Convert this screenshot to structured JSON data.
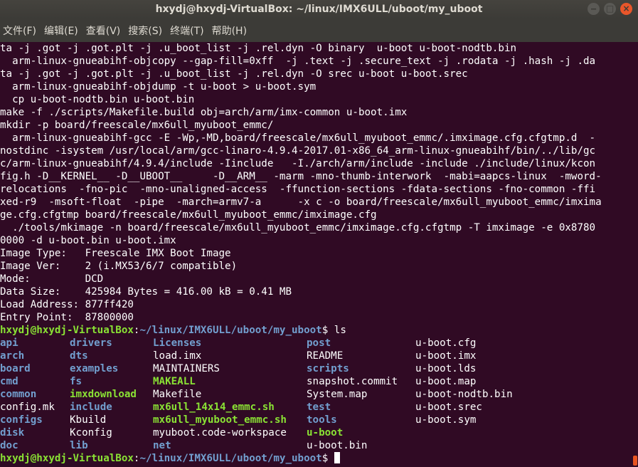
{
  "window": {
    "title": "hxydj@hxydj-VirtualBox: ~/linux/IMX6ULL/uboot/my_uboot",
    "minimize_label": "‒",
    "maximize_label": "□",
    "close_label": "×"
  },
  "menubar": {
    "items": [
      "文件(F)",
      "编辑(E)",
      "查看(V)",
      "搜索(S)",
      "终端(T)",
      "帮助(H)"
    ]
  },
  "terminal": {
    "output_lines": [
      "ta -j .got -j .got.plt -j .u_boot_list -j .rel.dyn -O binary  u-boot u-boot-nodtb.bin",
      "  arm-linux-gnueabihf-objcopy --gap-fill=0xff  -j .text -j .secure_text -j .rodata -j .hash -j .da",
      "ta -j .got -j .got.plt -j .u_boot_list -j .rel.dyn -O srec u-boot u-boot.srec",
      "  arm-linux-gnueabihf-objdump -t u-boot > u-boot.sym",
      "  cp u-boot-nodtb.bin u-boot.bin",
      "make -f ./scripts/Makefile.build obj=arch/arm/imx-common u-boot.imx",
      "mkdir -p board/freescale/mx6ull_myuboot_emmc/",
      "  arm-linux-gnueabihf-gcc -E -Wp,-MD,board/freescale/mx6ull_myuboot_emmc/.imximage.cfg.cfgtmp.d  -",
      "nostdinc -isystem /usr/local/arm/gcc-linaro-4.9.4-2017.01-x86_64_arm-linux-gnueabihf/bin/../lib/gc",
      "c/arm-linux-gnueabihf/4.9.4/include -Iinclude   -I./arch/arm/include -include ./include/linux/kcon",
      "fig.h -D__KERNEL__ -D__UBOOT__     -D__ARM__ -marm -mno-thumb-interwork  -mabi=aapcs-linux  -mword-",
      "relocations  -fno-pic  -mno-unaligned-access  -ffunction-sections -fdata-sections -fno-common -ffi",
      "xed-r9  -msoft-float  -pipe  -march=armv7-a      -x c -o board/freescale/mx6ull_myuboot_emmc/imxima",
      "ge.cfg.cfgtmp board/freescale/mx6ull_myuboot_emmc/imximage.cfg",
      "  ./tools/mkimage -n board/freescale/mx6ull_myuboot_emmc/imximage.cfg.cfgtmp -T imximage -e 0x8780",
      "0000 -d u-boot.bin u-boot.imx",
      "Image Type:   Freescale IMX Boot Image",
      "Image Ver:    2 (i.MX53/6/7 compatible)",
      "Mode:         DCD",
      "Data Size:    425984 Bytes = 416.00 kB = 0.41 MB",
      "Load Address: 877ff420",
      "Entry Point:  87800000"
    ],
    "prompt_user": "hxydj@hxydj-VirtualBox",
    "prompt_path": "~/linux/IMX6ULL/uboot/my_uboot",
    "prompt_symbol": "$",
    "command": " ls",
    "ls_output": [
      [
        {
          "name": "api",
          "type": "dir"
        },
        {
          "name": "drivers",
          "type": "dir"
        },
        {
          "name": "Licenses",
          "type": "dir"
        },
        {
          "name": "post",
          "type": "dir"
        },
        {
          "name": "u-boot.cfg",
          "type": "file"
        }
      ],
      [
        {
          "name": "arch",
          "type": "dir"
        },
        {
          "name": "dts",
          "type": "dir"
        },
        {
          "name": "load.imx",
          "type": "file"
        },
        {
          "name": "README",
          "type": "file"
        },
        {
          "name": "u-boot.imx",
          "type": "file"
        }
      ],
      [
        {
          "name": "board",
          "type": "dir"
        },
        {
          "name": "examples",
          "type": "dir"
        },
        {
          "name": "MAINTAINERS",
          "type": "file"
        },
        {
          "name": "scripts",
          "type": "dir"
        },
        {
          "name": "u-boot.lds",
          "type": "file"
        }
      ],
      [
        {
          "name": "cmd",
          "type": "dir"
        },
        {
          "name": "fs",
          "type": "dir"
        },
        {
          "name": "MAKEALL",
          "type": "exe"
        },
        {
          "name": "snapshot.commit",
          "type": "file"
        },
        {
          "name": "u-boot.map",
          "type": "file"
        }
      ],
      [
        {
          "name": "common",
          "type": "dir"
        },
        {
          "name": "imxdownload",
          "type": "exe"
        },
        {
          "name": "Makefile",
          "type": "file"
        },
        {
          "name": "System.map",
          "type": "file"
        },
        {
          "name": "u-boot-nodtb.bin",
          "type": "file"
        }
      ],
      [
        {
          "name": "config.mk",
          "type": "file"
        },
        {
          "name": "include",
          "type": "dir"
        },
        {
          "name": "mx6ull_14x14_emmc.sh",
          "type": "exe"
        },
        {
          "name": "test",
          "type": "dir"
        },
        {
          "name": "u-boot.srec",
          "type": "file"
        }
      ],
      [
        {
          "name": "configs",
          "type": "dir"
        },
        {
          "name": "Kbuild",
          "type": "file"
        },
        {
          "name": "mx6ull_myuboot_emmc.sh",
          "type": "exe"
        },
        {
          "name": "tools",
          "type": "dir"
        },
        {
          "name": "u-boot.sym",
          "type": "file"
        }
      ],
      [
        {
          "name": "disk",
          "type": "dir"
        },
        {
          "name": "Kconfig",
          "type": "file"
        },
        {
          "name": "myuboot.code-workspace",
          "type": "file"
        },
        {
          "name": "u-boot",
          "type": "exe"
        },
        {
          "name": ""
        }
      ],
      [
        {
          "name": "doc",
          "type": "dir"
        },
        {
          "name": "lib",
          "type": "dir"
        },
        {
          "name": "net",
          "type": "dir"
        },
        {
          "name": "u-boot.bin",
          "type": "file"
        },
        {
          "name": ""
        }
      ]
    ]
  },
  "colors": {
    "background": "#300a24",
    "directory": "#729fcf",
    "executable": "#8ae234",
    "prompt_user": "#8ae234",
    "prompt_path": "#729fcf",
    "text": "#ffffff"
  }
}
